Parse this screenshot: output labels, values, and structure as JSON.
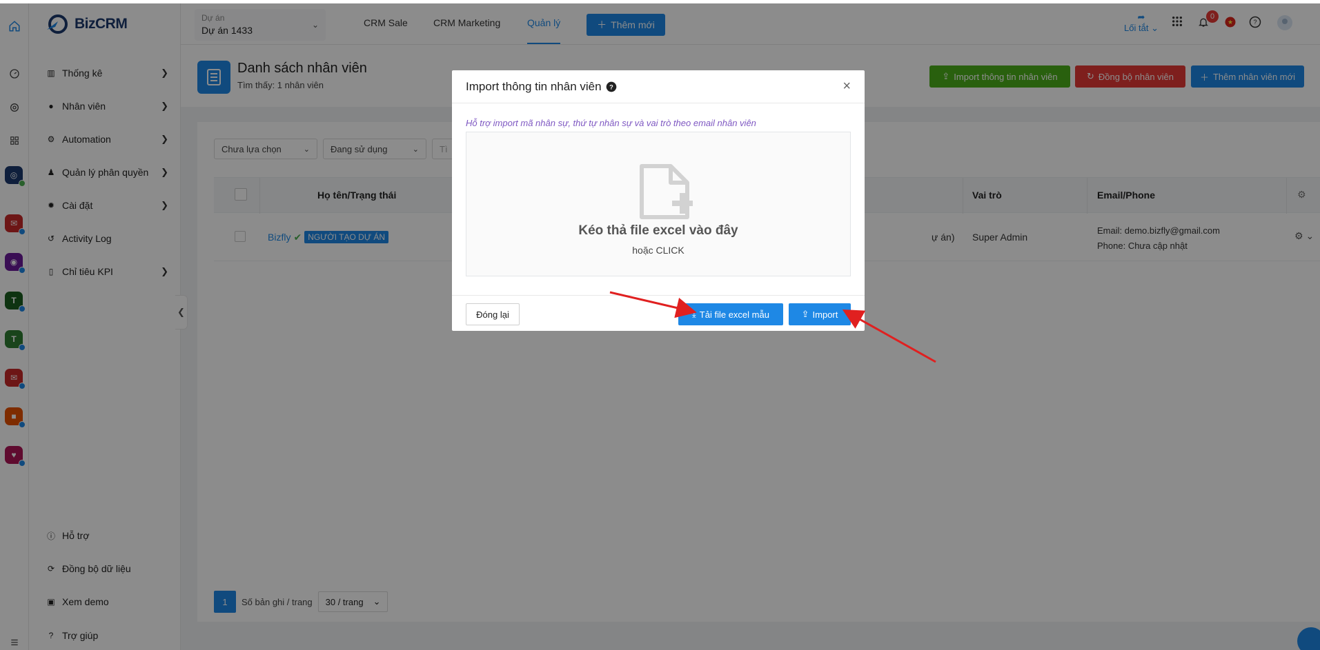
{
  "app": {
    "logo_text": "Biz",
    "logo_text_bold": "CRM"
  },
  "sidebar": {
    "items": [
      {
        "label": "Thống kê",
        "icon": "bar-chart-icon",
        "chevron": true
      },
      {
        "label": "Nhân viên",
        "icon": "user-icon",
        "chevron": true
      },
      {
        "label": "Automation",
        "icon": "automation-icon",
        "chevron": true
      },
      {
        "label": "Quản lý phân quyền",
        "icon": "admin-icon",
        "chevron": true
      },
      {
        "label": "Cài đặt",
        "icon": "gear-icon",
        "chevron": true
      },
      {
        "label": "Activity Log",
        "icon": "history-icon",
        "chevron": false
      },
      {
        "label": "Chỉ tiêu KPI",
        "icon": "mobile-icon",
        "chevron": true
      }
    ],
    "bottom_items": [
      {
        "label": "Hỗ trợ",
        "icon": "info-icon"
      },
      {
        "label": "Đồng bộ dữ liệu",
        "icon": "sync-icon"
      },
      {
        "label": "Xem demo",
        "icon": "demo-icon"
      },
      {
        "label": "Trợ giúp",
        "icon": "help-icon"
      }
    ]
  },
  "header": {
    "project_label": "Dự án",
    "project_value": "Dự án 1433",
    "nav": [
      "CRM Sale",
      "CRM Marketing",
      "Quản lý"
    ],
    "active_nav": "Quản lý",
    "new_button": "Thêm mới",
    "shortcut_label": "Lối tắt",
    "notification_count": "0"
  },
  "page": {
    "title": "Danh sách nhân viên",
    "subtitle": "Tìm thấy: 1 nhân viên",
    "actions": {
      "import": "Import thông tin nhân viên",
      "sync": "Đồng bộ nhân viên",
      "add": "Thêm nhân viên mới"
    }
  },
  "filters": {
    "select1": "Chưa lựa chọn",
    "select2": "Đang sử dụng",
    "select3": "Tì"
  },
  "table": {
    "columns": {
      "name": "Họ tên/Trạng thái",
      "role": "Vai trò",
      "contact": "Email/Phone"
    },
    "rows": [
      {
        "name": "Bizfly",
        "tag": "NGƯỜI TẠO DỰ ÁN",
        "partial": "ự án)",
        "role": "Super Admin",
        "email": "Email: demo.bizfly@gmail.com",
        "phone": "Phone: Chưa cập nhật"
      }
    ]
  },
  "pagination": {
    "page": "1",
    "per_page_label": "Số bản ghi / trang",
    "per_page_value": "30 / trang"
  },
  "modal": {
    "title": "Import thông tin nhân viên",
    "hint": "Hỗ trợ import mã nhân sự, thứ tự nhân sự và vai trò theo email nhân viên",
    "drop_text": "Kéo thả file excel vào đây",
    "drop_sub": "hoặc CLICK",
    "close_button": "Đóng lại",
    "template_button": "Tải file excel mẫu",
    "import_button": "Import"
  },
  "colors": {
    "primary": "#1e88e5",
    "green": "#4caf1a",
    "red": "#e53935",
    "arrow": "#e02020"
  }
}
